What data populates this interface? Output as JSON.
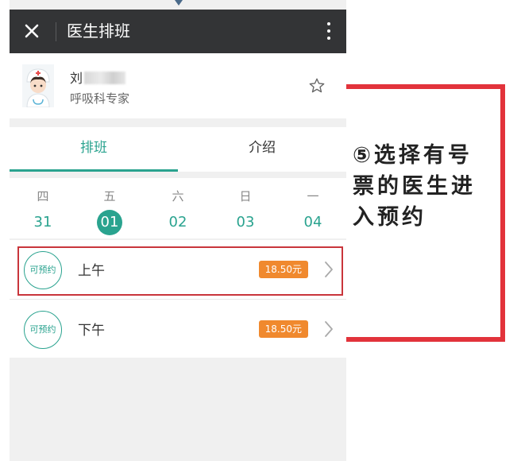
{
  "titlebar": {
    "title": "医生排班"
  },
  "doctor": {
    "name": "刘",
    "title": "呼吸科专家"
  },
  "tabs": [
    {
      "label": "排班"
    },
    {
      "label": "介绍"
    }
  ],
  "dates": [
    {
      "weekday": "四",
      "day": "31"
    },
    {
      "weekday": "五",
      "day": "01",
      "selected": true
    },
    {
      "weekday": "六",
      "day": "02"
    },
    {
      "weekday": "日",
      "day": "03"
    },
    {
      "weekday": "一",
      "day": "04"
    }
  ],
  "slots": [
    {
      "badge": "可预约",
      "label": "上午",
      "price": "18.50元"
    },
    {
      "badge": "可预约",
      "label": "下午",
      "price": "18.50元"
    }
  ],
  "annotation": {
    "text": "⑤选择有号票的医生进入预约"
  },
  "colors": {
    "accent": "#2aa38f",
    "price": "#f0892e",
    "highlight": "#e2333b",
    "titlebar": "#333436"
  }
}
